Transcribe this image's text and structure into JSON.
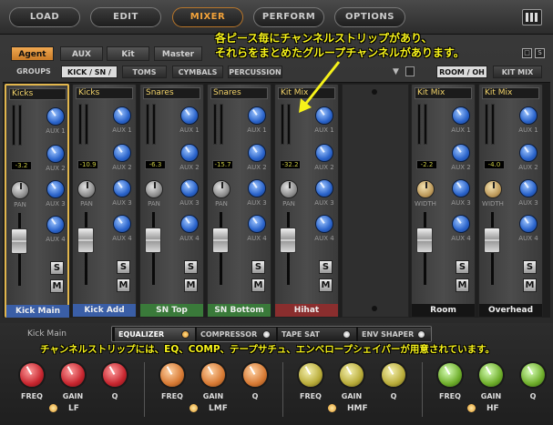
{
  "nav": {
    "items": [
      "LOAD",
      "EDIT",
      "MIXER",
      "PERFORM",
      "OPTIONS"
    ],
    "active": "MIXER"
  },
  "tabs": {
    "items": [
      "Agent",
      "AUX",
      "Kit",
      "Master"
    ],
    "active": "Agent",
    "box1": "□",
    "box2": "S"
  },
  "groups": {
    "items": [
      "GROUPS",
      "KICK / SN / HH",
      "TOMS",
      "CYMBALS",
      "PERCUSSION"
    ],
    "active": "KICK / SN / HH",
    "right": [
      "ROOM / OH",
      "KIT MIX"
    ],
    "right_active": "ROOM / OH"
  },
  "strips": [
    {
      "name": "Kicks",
      "db": "-3.2",
      "footer": "Kick Main",
      "footer_color": "#3a5ea6",
      "pan_label": "PAN"
    },
    {
      "name": "Kicks",
      "db": "-10.9",
      "footer": "Kick Add",
      "footer_color": "#3a5ea6",
      "pan_label": "PAN"
    },
    {
      "name": "Snares",
      "db": "-6.3",
      "footer": "SN Top",
      "footer_color": "#3a7a3a",
      "pan_label": "PAN"
    },
    {
      "name": "Snares",
      "db": "-15.7",
      "footer": "SN Bottom",
      "footer_color": "#3a7a3a",
      "pan_label": "PAN"
    },
    {
      "name": "Kit Mix",
      "db": "-32.2",
      "footer": "Hihat",
      "footer_color": "#8a2e2e",
      "pan_label": "PAN"
    },
    {
      "name": "Kit Mix",
      "db": "-2.2",
      "footer": "Room",
      "footer_color": "#151515",
      "pan_label": "WIDTH"
    },
    {
      "name": "Kit Mix",
      "db": "-4.0",
      "footer": "Overhead",
      "footer_color": "#151515",
      "pan_label": "WIDTH"
    }
  ],
  "aux_labels": [
    "AUX 1",
    "AUX 2",
    "AUX 3",
    "AUX 4"
  ],
  "solo_label": "S",
  "mute_label": "M",
  "channel": {
    "name": "Kick Main",
    "fx": [
      {
        "label": "EQUALIZER",
        "active": true
      },
      {
        "label": "COMPRESSOR",
        "active": false
      },
      {
        "label": "TAPE SAT",
        "active": false
      },
      {
        "label": "ENV SHAPER",
        "active": false
      }
    ],
    "bands": [
      {
        "name": "LF",
        "color": "red"
      },
      {
        "name": "LMF",
        "color": "orange"
      },
      {
        "name": "HMF",
        "color": "yellow"
      },
      {
        "name": "HF",
        "color": "green"
      }
    ],
    "knob_labels": [
      "FREQ",
      "GAIN",
      "Q"
    ]
  },
  "annotations": {
    "top_line1": "各ピース毎にチャンネルストリップがあり、",
    "top_line2": "それらをまとめたグループチャンネルがあります。",
    "bottom": "チャンネルストリップには、EQ、COMP、テープサチュ、エンベロープシェイパーが用意されています。"
  }
}
